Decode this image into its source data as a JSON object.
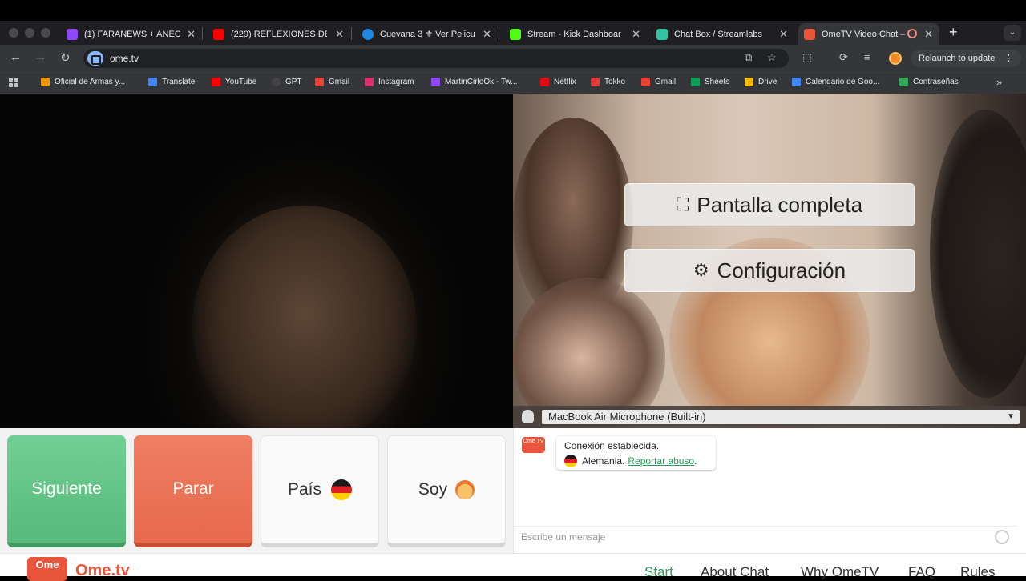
{
  "browser": {
    "tabs": [
      {
        "title": "(1) FARANEWS + ANECD",
        "favicon_color": "#9146ff"
      },
      {
        "title": "(229) REFLEXIONES DE",
        "favicon_color": "#ff0000"
      },
      {
        "title": "Cuevana 3 ⚜ Ver Pelicu",
        "favicon_color": "#1e88e5"
      },
      {
        "title": "Stream - Kick Dashboar",
        "favicon_color": "#53fc18"
      },
      {
        "title": "Chat Box / Streamlabs",
        "favicon_color": "#31c3a2"
      },
      {
        "title": "OmeTV Video Chat –",
        "favicon_color": "#e8553b"
      }
    ],
    "url": "ome.tv",
    "relaunch_label": "Relaunch to update",
    "bookmarks": [
      {
        "label": "Oficial de Armas y...",
        "color": "#f29900"
      },
      {
        "label": "Translate",
        "color": "#4285f4"
      },
      {
        "label": "YouTube",
        "color": "#ff0000"
      },
      {
        "label": "GPT",
        "color": "#444444"
      },
      {
        "label": "Gmail",
        "color": "#ea4335"
      },
      {
        "label": "Instagram",
        "color": "#e1306c"
      },
      {
        "label": "MartinCirloOk - Tw...",
        "color": "#9146ff"
      },
      {
        "label": "Netflix",
        "color": "#e50914"
      },
      {
        "label": "Tokko",
        "color": "#e53935"
      },
      {
        "label": "Gmail",
        "color": "#ea4335"
      },
      {
        "label": "Sheets",
        "color": "#0f9d58"
      },
      {
        "label": "Drive",
        "color": "#fbbc04"
      },
      {
        "label": "Calendario de Goo...",
        "color": "#4285f4"
      },
      {
        "label": "Contraseñas",
        "color": "#34a853"
      }
    ]
  },
  "video": {
    "fullscreen_label": "Pantalla completa",
    "settings_label": "Configuración",
    "microphone": "MacBook Air Microphone (Built-in)"
  },
  "controls": {
    "next_label": "Siguiente",
    "stop_label": "Parar",
    "country_label": "País",
    "gender_label": "Soy"
  },
  "chat": {
    "logo_text": "Ome TV",
    "connection_text": "Conexión establecida.",
    "country_text": "Alemania.",
    "report_link": "Reportar abuso",
    "input_placeholder": "Escribe un mensaje"
  },
  "footer": {
    "logo_text": "Ome",
    "brand": "Ome.tv",
    "nav": [
      "Start",
      "About Chat",
      "Why OmeTV",
      "FAQ",
      "Rules"
    ]
  },
  "colors": {
    "accent_green": "#2b9c5b",
    "brand_orange": "#e8553b",
    "next_green": "#57b97b",
    "stop_red": "#e7694c"
  }
}
